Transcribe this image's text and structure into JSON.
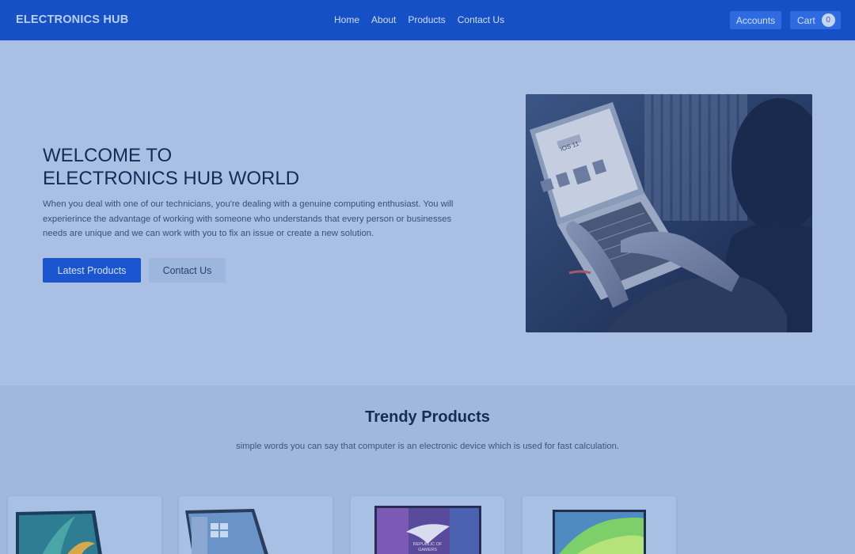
{
  "navbar": {
    "brand": "ELECTRONICS HUB",
    "links": [
      "Home",
      "About",
      "Products",
      "Contact Us"
    ],
    "accounts_label": "Accounts",
    "cart_label": "Cart",
    "cart_count": "0"
  },
  "hero": {
    "title_line1": "WELCOME TO",
    "title_line2": "ELECTRONICS HUB WORLD",
    "description": "When you deal with one of our technicians, you're dealing with a genuine computing enthusiast. You will experierince the advantage of working with someone who understands that every person or businesses needs are unique and we can work with you to fix an issue or create a new solution.",
    "primary_button": "Latest Products",
    "secondary_button": "Contact Us",
    "image_screen_text": "iOS 11"
  },
  "trendy": {
    "title": "Trendy Products",
    "subtitle": "simple words you can say that computer is an electronic device which is used for fast calculation.",
    "products": [
      {
        "image": "laptop-tropical-wallpaper"
      },
      {
        "image": "laptop-windows-desktop"
      },
      {
        "image": "laptop-republic-of-gamers",
        "screen_text_1": "REPUBLIC OF",
        "screen_text_2": "GAMERS"
      },
      {
        "image": "laptop-green-wave"
      }
    ]
  },
  "colors": {
    "navbar": "#1550c7",
    "page_bg": "#a9c0e4",
    "primary": "#1a55cf"
  }
}
